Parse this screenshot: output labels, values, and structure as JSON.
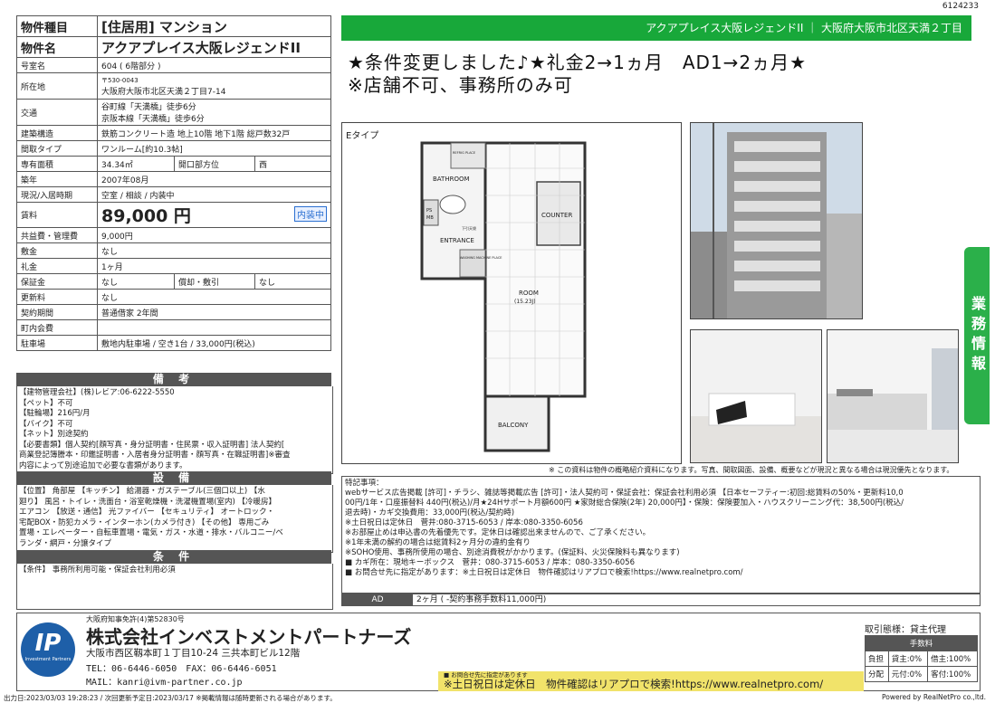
{
  "id_number": "6124233",
  "left": {
    "rows": [
      {
        "label": "物件種目",
        "value": "[住居用] マンション",
        "big": true
      },
      {
        "label": "物件名",
        "value": "アクアプレイス大阪レジェンドII",
        "big": true
      },
      {
        "label": "号室名",
        "value": "604 ( 6階部分 )"
      },
      {
        "label": "所在地",
        "value": "〒530-0043",
        "value2": "大阪府大阪市北区天満２丁目7-14"
      },
      {
        "label": "交通",
        "value": "谷町線「天満橋」徒歩6分",
        "value2": "京阪本線「天満橋」徒歩6分"
      },
      {
        "label": "建築構造",
        "value": "鉄筋コンクリート造 地上10階 地下1階 総戸数32戸"
      },
      {
        "label": "間取タイプ",
        "value": "ワンルーム[約10.3帖]"
      },
      {
        "label": "専有面積",
        "value": "34.34㎡",
        "sub_label": "開口部方位",
        "sub_value": "西"
      },
      {
        "label": "築年",
        "value": "2007年08月"
      },
      {
        "label": "現況/入居時期",
        "value": "空室 / 相談 / 内装中"
      },
      {
        "label": "賃料",
        "value": "89,000 円",
        "badge": "内装中",
        "rent": true
      },
      {
        "label": "共益費・管理費",
        "value": "9,000円"
      },
      {
        "label": "敷金",
        "value": "なし"
      },
      {
        "label": "礼金",
        "value": "1ヶ月"
      },
      {
        "label": "保証金",
        "value": "なし",
        "sub_label": "償却・敷引",
        "sub_value": "なし"
      },
      {
        "label": "更新料",
        "value": "なし"
      },
      {
        "label": "契約期間",
        "value": "普通借家 2年間"
      },
      {
        "label": "町内会費",
        "value": ""
      },
      {
        "label": "駐車場",
        "value": "敷地内駐車場 / 空き1台 / 33,000円(税込)"
      }
    ],
    "biko_title": "備 考",
    "biko_lines": [
      "【建物管理会社】(株)レビア:06-6222-5550",
      "【ペット】不可",
      "【駐輪場】216円/月",
      "【バイク】不可",
      "【ネット】別途契約",
      "【必要書類】個人契約[顔写真・身分証明書・住民票・収入証明書] 法人契約[",
      "商業登記簿謄本・印鑑証明書・入居者身分証明書・顔写真・在職証明書]※審査",
      "内容によって別途追加で必要な書類があります。"
    ],
    "setsubi_title": "設 備",
    "setsubi_lines": [
      "【位置】 角部屋 【キッチン】 給湯器・ガステーブル(三個口以上) 【水",
      "廻り】 風呂・トイレ・洗面台・浴室乾燥機・洗濯機置場(室内) 【冷暖房】",
      "エアコン 【放送・通信】 光ファイバー 【セキュリティ】 オートロック・",
      "宅配BOX・防犯カメラ・インターホン(カメラ付き) 【その他】 専用ごみ",
      "置場・エレベーター・自転車置場・電気・ガス・水道・排水・バルコニー/ベ",
      "ランダ・網戸・分譲タイプ"
    ],
    "joken_title": "条 件",
    "joken_lines": [
      "【条件】 事務所利用可能・保証会社利用必須"
    ]
  },
  "header": {
    "green_bar": "アクアプレイス大阪レジェンドII ｜ 大阪府大阪市北区天満２丁目",
    "headline1": "★条件変更しました♪★礼金2→1ヵ月　AD1→2ヵ月★",
    "headline2": "※店舗不可、事務所のみ可",
    "side_tab": "業務情報"
  },
  "floorplan": {
    "type_label": "Eタイプ",
    "rooms": [
      "BATHROOM",
      "COUNTER",
      "ENTRANCE",
      "ROOM",
      "(15.23J)",
      "BALCONY",
      "PS",
      "MB",
      "下引天袋",
      "WASHING MACHINE PLACE",
      "REFRIG PLACE"
    ]
  },
  "photo_note": "※ この資料は物件の概略紹介資料になります。写真、間取図面、設備、概要などが現況と異なる場合は現況優先となります。",
  "tokki": {
    "title": "特記事項：",
    "lines": [
      "webサービス広告掲載 [許可]・チラシ、雑誌等掲載広告 [許可]・法人契約可・保証会社：保証会社利用必須 【日本セーフティー:初回:総賃料の50%・更新料10,0",
      "00円/1年・口座振替料 440円(税込)/月★24Hサポート月額600円 ★家財総合保険(2年) 20,000円】・保険：保険要加入・ハウスクリーニング代：38,500円(税込/",
      "退去時)・カギ交換費用：33,000円(税込/契約時)",
      "※土日祝日は定休日　菅井:080-3715-6053 / 岸本:080-3350-6056",
      "※お部屋止めは申込書の先着優先です。定休日は確認出来ませんので、ご了承ください。",
      "※1年未満の解約の場合は総賃料2ヶ月分の違約金有り",
      "※SOHO使用、事務所使用の場合、別途消費税がかかります。(保証料、火災保険料も異なります)",
      "■ カギ所在：現地キーボックス　菅井：080-3715-6053 / 岸本：080-3350-6056",
      "■ お問合せ先に指定があります：※土日祝日は定休日　物件確認はリアプロで検索!https://www.realnetpro.com/"
    ]
  },
  "ad": {
    "label": "AD",
    "value": "2ヶ月 ( -契約事務手数料11,000円)"
  },
  "footer": {
    "license": "大阪府知事免許(4)第52830号",
    "company": "株式会社インベストメントパートナーズ",
    "address": "大阪市西区靱本町１丁目10-24 三共本町ビル12階",
    "tel_fax": "TEL：06-6446-6050　FAX：06-6446-6051",
    "mail": "MAIL：kanri@ivm-partner.co.jp",
    "logo_text": "IP",
    "logo_sub": "Investment Partners",
    "notice_small": "■ お問合せ先に指定があります",
    "notice_big": "※土日祝日は定休日　物件確認はリアプロで検索!https://www.realnetpro.com/",
    "torihiki_label": "取引態様：",
    "torihiki_value": "貸主代理",
    "fee_title": "手数料",
    "fee_rows": [
      {
        "label": "負担",
        "a": "貸主:0%",
        "b": "借主:100%"
      },
      {
        "label": "分配",
        "a": "元付:0%",
        "b": "客付:100%"
      }
    ],
    "print_date": "出力日:2023/03/03 19:28:23 / 次回更新予定日:2023/03/17 ※掲載情報は随時更新される場合があります。",
    "powered": "Powered by RealNetPro co.,ltd."
  },
  "colors": {
    "green": "#18a83a",
    "side_tab": "#2bb04a",
    "section_head": "#555555",
    "badge_blue": "#2a6fd1"
  }
}
